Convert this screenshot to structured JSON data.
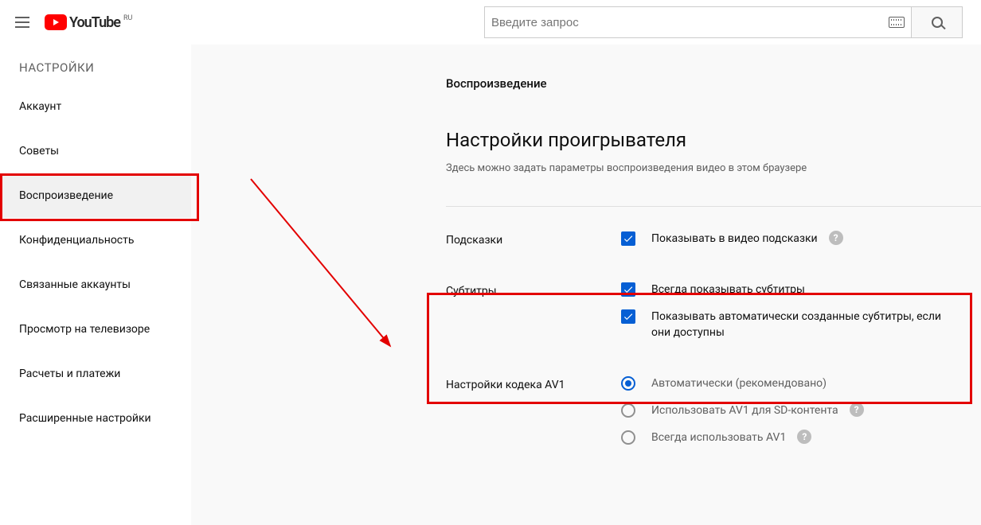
{
  "header": {
    "logo_text": "YouTube",
    "logo_region": "RU",
    "search_placeholder": "Введите запрос"
  },
  "sidebar": {
    "title": "НАСТРОЙКИ",
    "items": [
      {
        "label": "Аккаунт"
      },
      {
        "label": "Советы"
      },
      {
        "label": "Воспроизведение"
      },
      {
        "label": "Конфиденциальность"
      },
      {
        "label": "Связанные аккаунты"
      },
      {
        "label": "Просмотр на телевизоре"
      },
      {
        "label": "Расчеты и платежи"
      },
      {
        "label": "Расширенные настройки"
      }
    ],
    "active_index": 2
  },
  "page": {
    "breadcrumb": "Воспроизведение",
    "heading": "Настройки проигрывателя",
    "subtitle": "Здесь можно задать параметры воспроизведения видео в этом браузере",
    "sections": {
      "hints": {
        "label": "Подсказки",
        "option": "Показывать в видео подсказки",
        "checked": true,
        "has_help": true
      },
      "subtitles": {
        "label": "Субтитры",
        "options": [
          {
            "text": "Всегда показывать субтитры",
            "checked": true
          },
          {
            "text": "Показывать автоматически созданные субтитры, если они доступны",
            "checked": true
          }
        ]
      },
      "av1": {
        "label": "Настройки кодека AV1",
        "options": [
          {
            "text": "Автоматически (рекомендовано)",
            "selected": true,
            "has_help": false
          },
          {
            "text": "Использовать AV1 для SD-контента",
            "selected": false,
            "has_help": true
          },
          {
            "text": "Всегда использовать AV1",
            "selected": false,
            "has_help": true
          }
        ]
      }
    }
  }
}
